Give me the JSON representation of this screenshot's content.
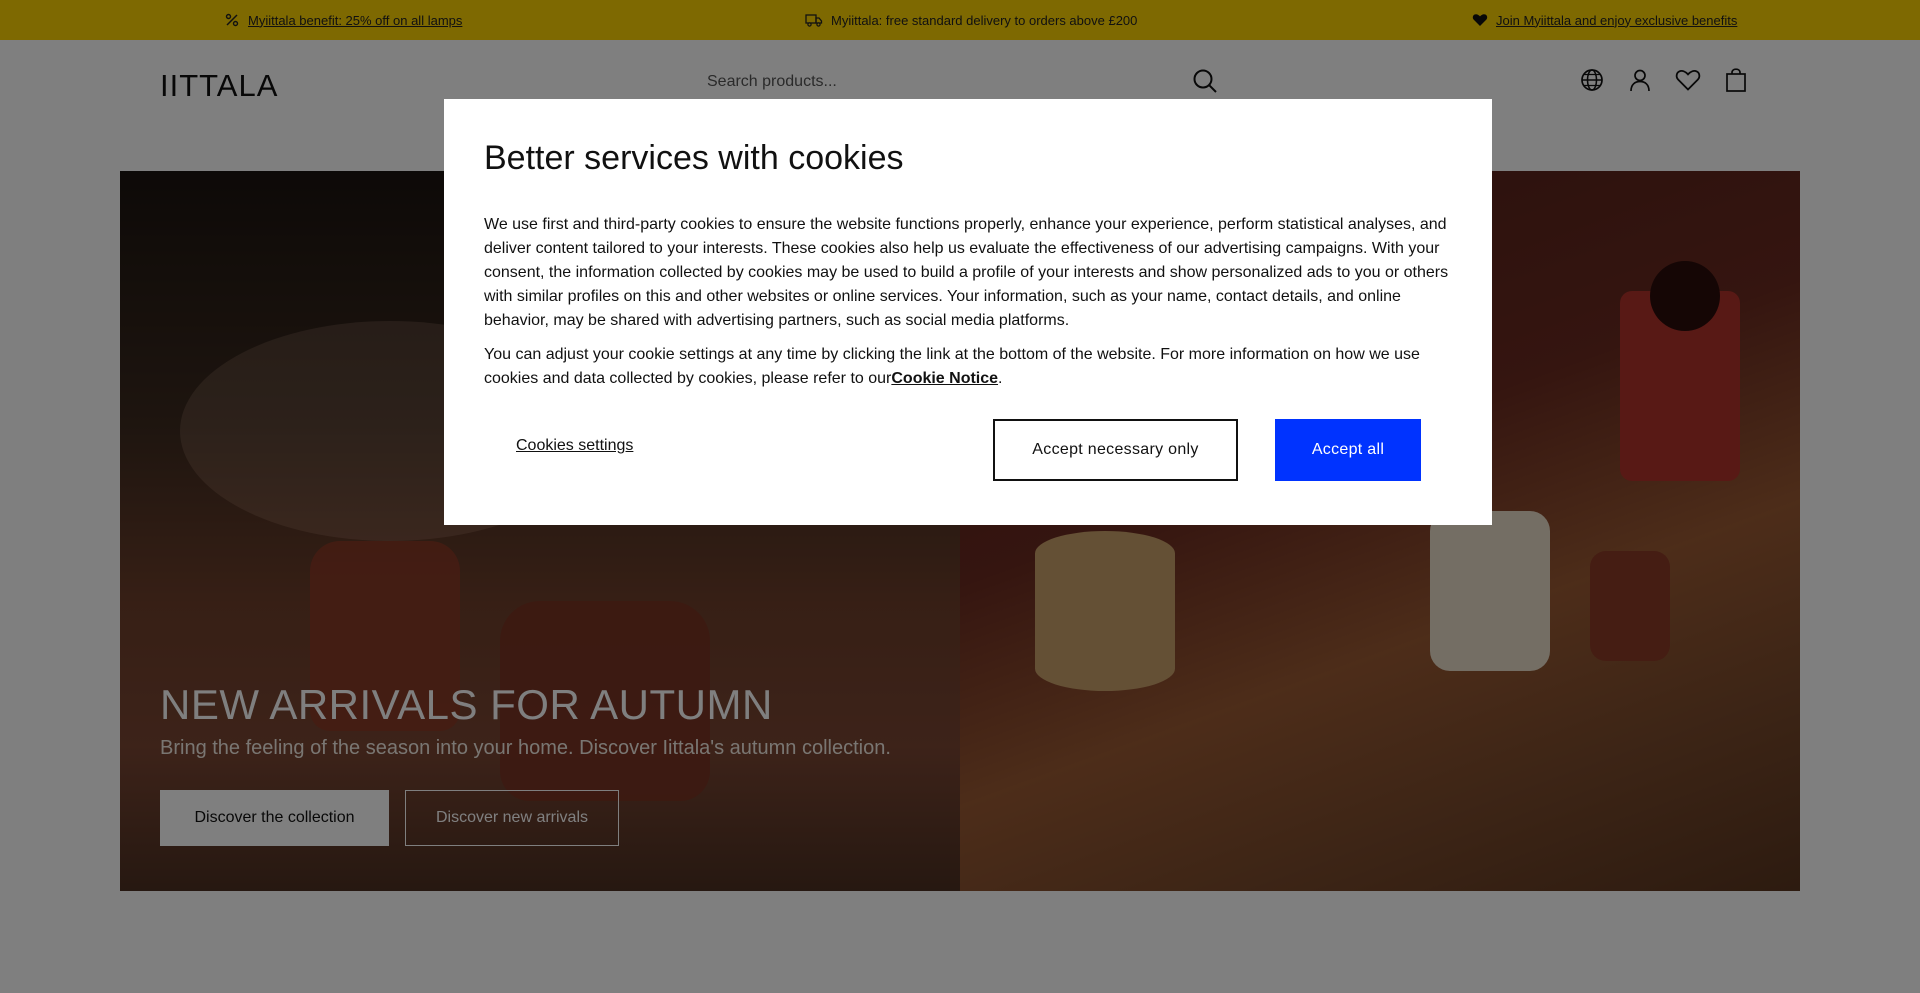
{
  "promo": {
    "items": [
      {
        "icon": "percent-icon",
        "text": "Myiittala benefit: 25% off on all lamps",
        "link": true
      },
      {
        "icon": "truck-icon",
        "text": "Myiittala: free standard delivery to orders above £200",
        "link": false
      },
      {
        "icon": "heart-filled-icon",
        "text": "Join Myiittala and enjoy exclusive benefits",
        "link": true
      }
    ],
    "background": "#fcd202"
  },
  "header": {
    "logo": "IITTALA",
    "search_placeholder": "Search products...",
    "icons": [
      "globe-icon",
      "user-icon",
      "heart-icon",
      "bag-icon"
    ]
  },
  "hero": {
    "title": "NEW ARRIVALS FOR AUTUMN",
    "subtitle": "Bring the feeling of the season into your home. Discover Iittala's autumn collection.",
    "primary_button": "Discover the collection",
    "secondary_button": "Discover new arrivals"
  },
  "cookie_modal": {
    "title": "Better services with cookies",
    "paragraph1": "We use first and third-party cookies to ensure the website functions properly, enhance your experience, perform statistical analyses, and deliver content tailored to your interests. These cookies also help us evaluate the effectiveness of our advertising campaigns. With your consent, the information collected by cookies may be used to build a profile of your interests and show personalized ads to you or others with similar profiles on this and other websites or online services. Your information, such as your name, contact details, and online behavior, may be shared with advertising partners, such as social media platforms.",
    "paragraph2_prefix": "You can adjust your cookie settings at any time by clicking the link at the bottom of the website. For more information on how we use cookies and data collected by cookies, please refer to our",
    "cookie_notice_link": "Cookie Notice",
    "paragraph2_suffix": ".",
    "settings_label": "Cookies settings",
    "necessary_label": "Accept necessary only",
    "accept_all_label": "Accept all",
    "accent_color": "#0033ff"
  }
}
